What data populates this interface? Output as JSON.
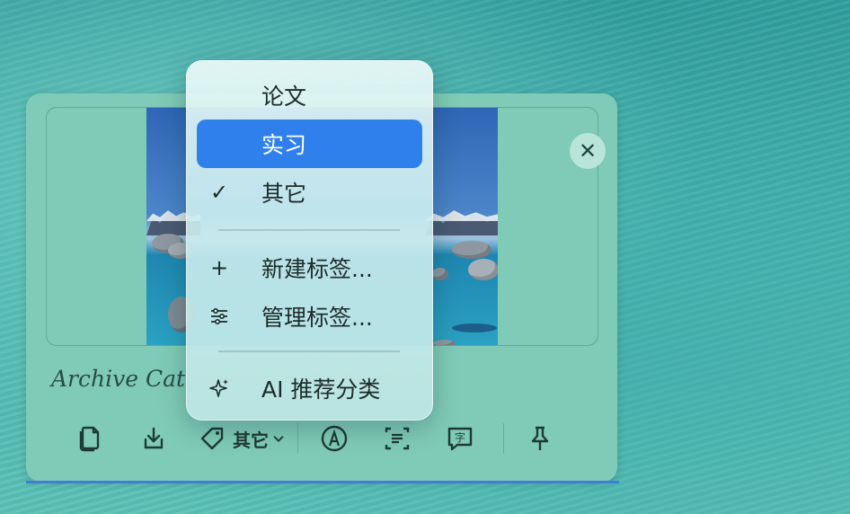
{
  "panel": {
    "caption": "Archive Cat",
    "close_icon": "close-icon"
  },
  "toolbar": {
    "tag_value": "其它",
    "icons": [
      "copy-icon",
      "download-icon",
      "tag-icon",
      "chevron-down-icon",
      "markup-icon",
      "scan-text-icon",
      "translate-icon",
      "pin-icon"
    ]
  },
  "menu": {
    "items": [
      {
        "label": "论文",
        "icon": ""
      },
      {
        "label": "实习",
        "icon": "",
        "highlighted": true
      },
      {
        "label": "其它",
        "icon": "✓",
        "checked": true
      },
      {
        "label": "新建标签...",
        "icon": "+"
      },
      {
        "label": "管理标签...",
        "icon": "sliders-icon"
      },
      {
        "label": "AI 推荐分类",
        "icon": "sparkles-icon"
      }
    ]
  },
  "colors": {
    "panel": "#7fcbb7",
    "highlight": "#2f80ed"
  }
}
